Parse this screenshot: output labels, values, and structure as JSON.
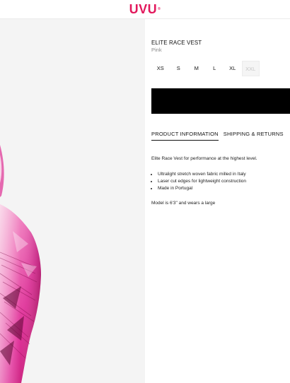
{
  "brand": {
    "logo_text": "UVU",
    "logo_mark": "®",
    "color": "#e2185c"
  },
  "product": {
    "name": "ELITE RACE VEST",
    "color_label": "Pink",
    "image_icon": "product-photo-pink-vest"
  },
  "sizes": [
    {
      "label": "XS",
      "available": true
    },
    {
      "label": "S",
      "available": true
    },
    {
      "label": "M",
      "available": true
    },
    {
      "label": "L",
      "available": true
    },
    {
      "label": "XL",
      "available": true
    },
    {
      "label": "XXL",
      "available": false
    }
  ],
  "add_button": {
    "label": "",
    "color": "#000000"
  },
  "tabs": [
    {
      "label": "PRODUCT INFORMATION",
      "active": true
    },
    {
      "label": "SHIPPING & RETURNS",
      "active": false
    }
  ],
  "description": {
    "intro": "Elite Race Vest for performance at the highest level.",
    "bullets": [
      "Ultralight stretch woven fabric milled in Italy",
      "Laser cut edges for lightweight construction",
      "Made in Portugal"
    ],
    "note": "Model is 6'3\" and wears a large"
  }
}
